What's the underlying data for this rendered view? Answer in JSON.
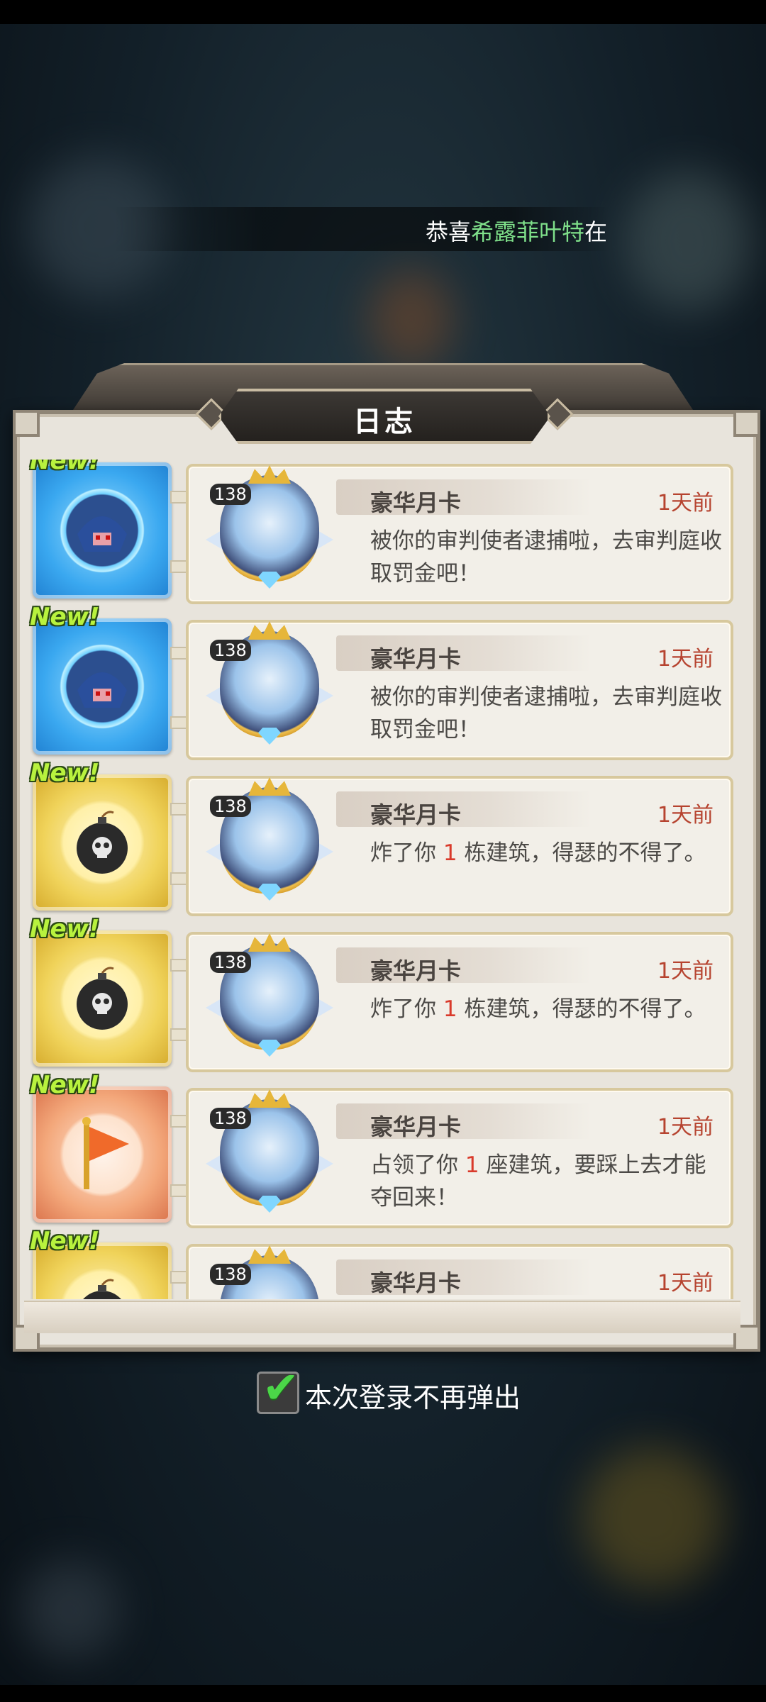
{
  "ticker": {
    "prefix": "恭喜",
    "player": "希露菲叶特",
    "suffix": "在"
  },
  "panel": {
    "title": "日志"
  },
  "entries": [
    {
      "icon": "blue-knight-icon",
      "new_label": "New!",
      "level": "138",
      "name": "豪华月卡",
      "time": "1天前",
      "message": "被你的审判使者逮捕啦，去审判庭收取罚金吧！"
    },
    {
      "icon": "blue-knight-icon",
      "new_label": "New!",
      "level": "138",
      "name": "豪华月卡",
      "time": "1天前",
      "message": "被你的审判使者逮捕啦，去审判庭收取罚金吧！"
    },
    {
      "icon": "bomb-icon",
      "new_label": "New!",
      "level": "138",
      "name": "豪华月卡",
      "time": "1天前",
      "message_pre": "炸了你 ",
      "message_num": "1",
      "message_post": " 栋建筑，得瑟的不得了。"
    },
    {
      "icon": "bomb-icon",
      "new_label": "New!",
      "level": "138",
      "name": "豪华月卡",
      "time": "1天前",
      "message_pre": "炸了你 ",
      "message_num": "1",
      "message_post": " 栋建筑，得瑟的不得了。"
    },
    {
      "icon": "flag-icon",
      "new_label": "New!",
      "level": "138",
      "name": "豪华月卡",
      "time": "1天前",
      "message_pre": "占领了你 ",
      "message_num": "1",
      "message_post": " 座建筑，要踩上去才能夺回来！"
    },
    {
      "icon": "bomb-icon",
      "new_label": "New!",
      "level": "138",
      "name": "豪华月卡",
      "time": "1天前"
    }
  ],
  "footer": {
    "checkbox_label": "本次登录不再弹出",
    "checked": true
  },
  "colors": {
    "accent_time": "#b6432f",
    "highlight_name": "#7fe08a",
    "new_badge": "#b8f23e",
    "check": "#4bd648"
  }
}
